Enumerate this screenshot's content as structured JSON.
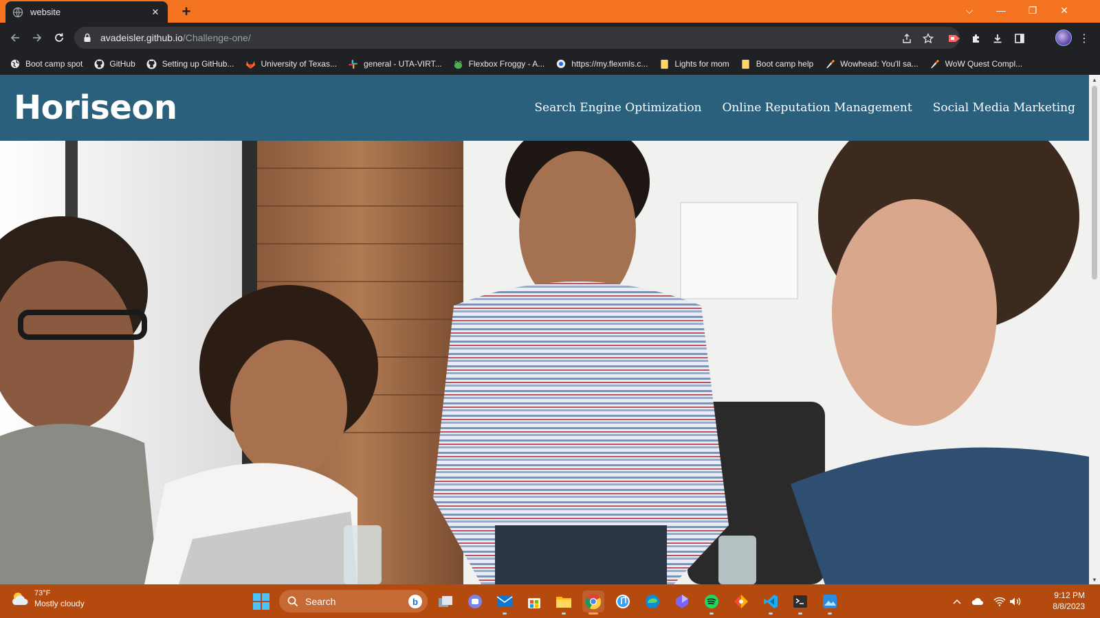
{
  "browser": {
    "tab": {
      "title": "website"
    },
    "address": {
      "host": "avadeisler.github.io",
      "path": "/Challenge-one/"
    },
    "bookmarks": [
      {
        "label": "Boot camp spot",
        "icon": "globe-icon"
      },
      {
        "label": "GitHub",
        "icon": "github-icon"
      },
      {
        "label": "Setting up GitHub...",
        "icon": "github-icon"
      },
      {
        "label": "University of Texas...",
        "icon": "gitlab-icon"
      },
      {
        "label": "general - UTA-VIRT...",
        "icon": "slack-icon"
      },
      {
        "label": "Flexbox Froggy - A...",
        "icon": "frog-icon"
      },
      {
        "label": "https://my.flexmls.c...",
        "icon": "flexmls-icon"
      },
      {
        "label": "Lights for mom",
        "icon": "folder-icon"
      },
      {
        "label": "Boot camp help",
        "icon": "folder-icon"
      },
      {
        "label": "Wowhead: You'll sa...",
        "icon": "wowhead-icon"
      },
      {
        "label": "WoW Quest Compl...",
        "icon": "wowhead-icon"
      }
    ]
  },
  "site": {
    "logo": "Horiseon",
    "nav": [
      {
        "label": "Search Engine Optimization"
      },
      {
        "label": "Online Reputation Management"
      },
      {
        "label": "Social Media Marketing"
      }
    ],
    "header_color": "#2a607c"
  },
  "taskbar": {
    "weather": {
      "temp": "73°F",
      "condition": "Mostly cloudy"
    },
    "search_placeholder": "Search",
    "clock": {
      "time": "9:12 PM",
      "date": "8/8/2023"
    },
    "accent": "#b54a0f"
  }
}
